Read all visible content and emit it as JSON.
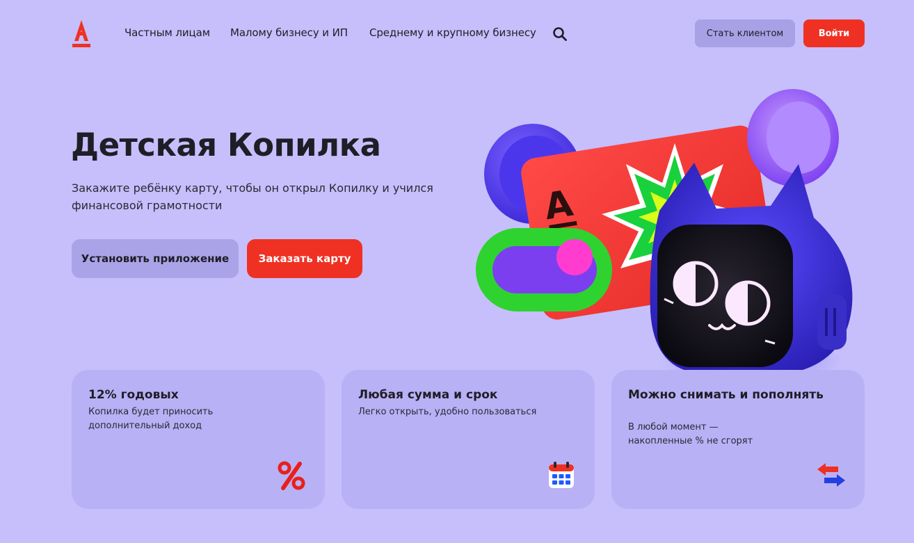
{
  "header": {
    "logo_letter": "А",
    "nav": [
      "Частным лицам",
      "Малому бизнесу и ИП",
      "Среднему и крупному бизнесу"
    ],
    "become_client": "Стать клиентом",
    "login": "Войти"
  },
  "hero": {
    "title": "Детская Копилка",
    "subtitle": "Закажите ребёнку карту, чтобы он открыл Копилку и учился финансовой грамотности",
    "install_app": "Установить приложение",
    "order_card": "Заказать карту"
  },
  "features": [
    {
      "title": "12% годовых",
      "text": "Копилка будет приносить дополнительный доход",
      "icon": "percent-icon"
    },
    {
      "title": "Любая сумма и срок",
      "text": "Легко открыть, удобно пользоваться",
      "icon": "calendar-icon"
    },
    {
      "title": "Можно снимать и пополнять",
      "text": "В любой момент — накопленные % не сгорят",
      "icon": "transfer-arrows-icon"
    }
  ],
  "colors": {
    "background": "#c6bffb",
    "brand_red": "#ef3124",
    "secondary_button": "#a8a1e6",
    "card_bg": "#b9b1f5"
  }
}
